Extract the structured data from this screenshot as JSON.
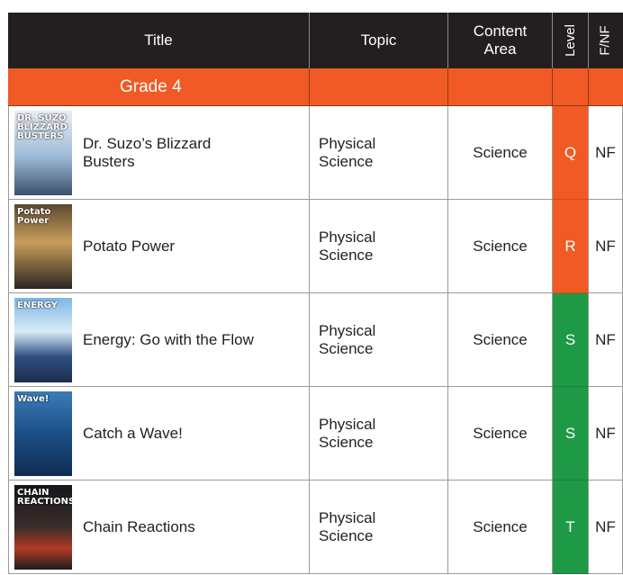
{
  "header": {
    "title": "Title",
    "topic": "Topic",
    "content_area": "Content Area",
    "level": "Level",
    "fnf": "F/NF"
  },
  "grade_label": "Grade 4",
  "colors": {
    "header_bg": "#231f20",
    "orange": "#f15a24",
    "green": "#1e9a46"
  },
  "rows": [
    {
      "title": "Dr. Suzo’s Blizzard Busters",
      "topic": "Physical Science",
      "area": "Science",
      "level": "Q",
      "fnf": "NF",
      "level_color": "orange",
      "cover_text": "DR. SUZO BLIZZARD BUSTERS"
    },
    {
      "title": "Potato Power",
      "topic": "Physical Science",
      "area": "Science",
      "level": "R",
      "fnf": "NF",
      "level_color": "orange",
      "cover_text": "Potato Power"
    },
    {
      "title": "Energy: Go with the Flow",
      "topic": "Physical Science",
      "area": "Science",
      "level": "S",
      "fnf": "NF",
      "level_color": "green",
      "cover_text": "ENERGY"
    },
    {
      "title": "Catch a Wave!",
      "topic": "Physical Science",
      "area": "Science",
      "level": "S",
      "fnf": "NF",
      "level_color": "green",
      "cover_text": "Wave!"
    },
    {
      "title": "Chain Reactions",
      "topic": "Physical Science",
      "area": "Science",
      "level": "T",
      "fnf": "NF",
      "level_color": "green",
      "cover_text": "CHAIN REACTIONS"
    }
  ]
}
